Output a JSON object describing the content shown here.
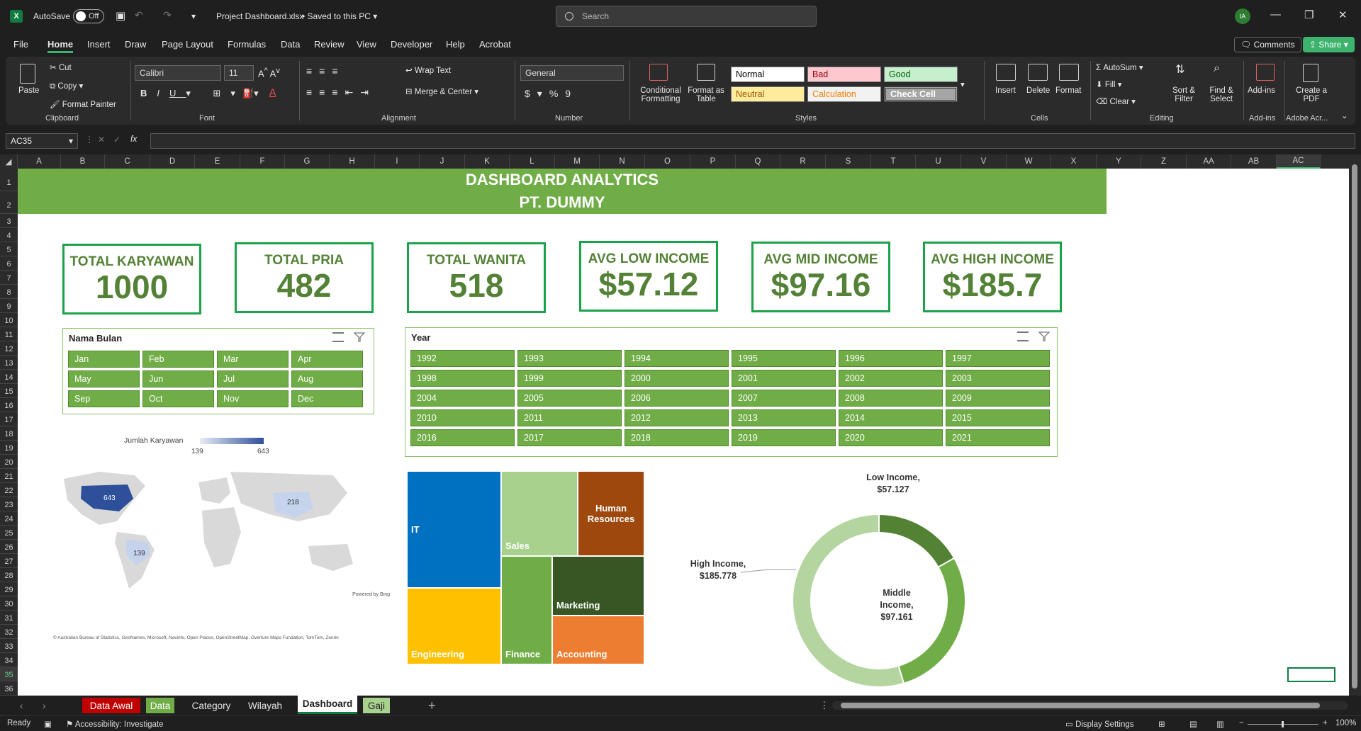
{
  "titlebar": {
    "autosave_label": "AutoSave",
    "autosave_state": "Off",
    "file_title": "Project Dashboard.xlsx",
    "save_status": "Saved to this PC",
    "search_placeholder": "Search",
    "user_initials": "IA"
  },
  "menu": [
    "File",
    "Home",
    "Insert",
    "Draw",
    "Page Layout",
    "Formulas",
    "Data",
    "Review",
    "View",
    "Developer",
    "Help",
    "Acrobat"
  ],
  "menu_active": "Home",
  "comments_label": "Comments",
  "share_label": "Share",
  "ribbon": {
    "clipboard": {
      "paste": "Paste",
      "cut": "Cut",
      "copy": "Copy",
      "format_painter": "Format Painter",
      "label": "Clipboard"
    },
    "font": {
      "name": "Calibri",
      "size": "11",
      "label": "Font"
    },
    "alignment": {
      "wrap": "Wrap Text",
      "merge": "Merge & Center",
      "label": "Alignment"
    },
    "number": {
      "format": "General",
      "label": "Number"
    },
    "styles": {
      "conditional": "Conditional Formatting",
      "format_table": "Format as Table",
      "cells": [
        {
          "name": "Normal",
          "bg": "#ffffff",
          "fg": "#000000"
        },
        {
          "name": "Bad",
          "bg": "#ffc7ce",
          "fg": "#9c0006"
        },
        {
          "name": "Good",
          "bg": "#c6efce",
          "fg": "#006100"
        },
        {
          "name": "Neutral",
          "bg": "#ffeb9c",
          "fg": "#9c5700"
        },
        {
          "name": "Calculation",
          "bg": "#f2f2f2",
          "fg": "#fa7d00"
        },
        {
          "name": "Check Cell",
          "bg": "#a5a5a5",
          "fg": "#ffffff"
        }
      ],
      "label": "Styles"
    },
    "cells": {
      "insert": "Insert",
      "delete": "Delete",
      "format": "Format",
      "label": "Cells"
    },
    "editing": {
      "autosum": "AutoSum",
      "fill": "Fill",
      "clear": "Clear",
      "sort": "Sort & Filter",
      "find": "Find & Select",
      "label": "Editing"
    },
    "addins": {
      "addins": "Add-ins",
      "label": "Add-ins"
    },
    "acrobat": {
      "create": "Create a PDF",
      "label": "Adobe Acr..."
    }
  },
  "formula_bar": {
    "name_box": "AC35",
    "fx": "fx",
    "content": ""
  },
  "columns": [
    "A",
    "B",
    "C",
    "D",
    "E",
    "F",
    "G",
    "H",
    "I",
    "J",
    "K",
    "L",
    "M",
    "N",
    "O",
    "P",
    "Q",
    "R",
    "S",
    "T",
    "U",
    "V",
    "W",
    "X",
    "Y",
    "Z",
    "AA",
    "AB",
    "AC"
  ],
  "selected_column": "AC",
  "rows": [
    "1",
    "2",
    "3",
    "4",
    "5",
    "6",
    "7",
    "8",
    "9",
    "10",
    "11",
    "12",
    "13",
    "14",
    "15",
    "16",
    "17",
    "18",
    "19",
    "20",
    "21",
    "22",
    "23",
    "24",
    "25",
    "26",
    "27",
    "28",
    "29",
    "30",
    "31",
    "32",
    "33",
    "34",
    "35",
    "36"
  ],
  "dashboard": {
    "title_line1": "DASHBOARD ANALYTICS",
    "title_line2": "PT. DUMMY",
    "kpis": [
      {
        "label": "TOTAL KARYAWAN",
        "value": "1000"
      },
      {
        "label": "TOTAL PRIA",
        "value": "482"
      },
      {
        "label": "TOTAL WANITA",
        "value": "518"
      },
      {
        "label": "AVG LOW INCOME",
        "value": "$57.12"
      },
      {
        "label": "AVG MID INCOME",
        "value": "$97.16"
      },
      {
        "label": "AVG HIGH INCOME",
        "value": "$185.7"
      }
    ],
    "slicer_month": {
      "title": "Nama Bulan",
      "items": [
        "Jan",
        "Feb",
        "Mar",
        "Apr",
        "May",
        "Jun",
        "Jul",
        "Aug",
        "Sep",
        "Oct",
        "Nov",
        "Dec"
      ]
    },
    "slicer_year": {
      "title": "Year",
      "items": [
        "1992",
        "1993",
        "1994",
        "1995",
        "1996",
        "1997",
        "1998",
        "1999",
        "2000",
        "2001",
        "2002",
        "2003",
        "2004",
        "2005",
        "2006",
        "2007",
        "2008",
        "2009",
        "2010",
        "2011",
        "2012",
        "2013",
        "2014",
        "2015",
        "2016",
        "2017",
        "2018",
        "2019",
        "2020",
        "2021"
      ]
    },
    "map": {
      "legend_title": "Jumlah Karyawan",
      "legend_min": "139",
      "legend_max": "643",
      "points": [
        {
          "country": "USA",
          "label": "643"
        },
        {
          "country": "China",
          "label": "218"
        },
        {
          "country": "Brazil",
          "label": "139"
        }
      ],
      "powered": "Powered by Bing",
      "credits": "© Australian Bureau of Statistics, GeoNames, Microsoft, Navinfo, Open Places, OpenStreetMap, Overture Maps Fundation, TomTom, Zenrin"
    }
  },
  "chart_data": [
    {
      "type": "treemap",
      "categories": [
        "IT",
        "Sales",
        "Human Resources",
        "Engineering",
        "Finance",
        "Marketing",
        "Accounting"
      ],
      "colors": [
        "#0070c0",
        "#a9d18e",
        "#9e480e",
        "#ffc000",
        "#70ad47",
        "#375623",
        "#ed7d31"
      ]
    },
    {
      "type": "pie",
      "variant": "doughnut",
      "categories": [
        "Low Income",
        "Middle Income",
        "High Income"
      ],
      "values": [
        57.127,
        97.161,
        185.778
      ],
      "labels": [
        "Low Income,\n$57.127",
        "Middle\nIncome,\n$97.161",
        "High Income,\n$185.778"
      ],
      "colors": [
        "#548235",
        "#70ad47",
        "#b5d5a0"
      ]
    }
  ],
  "sheet_tabs": [
    {
      "name": "Data Awal",
      "bg": "#c00000",
      "fg": "#ffffff"
    },
    {
      "name": "Data",
      "bg": "#70ad47",
      "fg": "#ffffff"
    },
    {
      "name": "Category",
      "bg": "",
      "fg": "#e6e6e6"
    },
    {
      "name": "Wilayah",
      "bg": "",
      "fg": "#e6e6e6"
    },
    {
      "name": "Dashboard",
      "bg": "#ffffff",
      "fg": "#1f1f1f"
    },
    {
      "name": "Gaji",
      "bg": "#a9d18e",
      "fg": "#1f1f1f"
    }
  ],
  "status": {
    "ready": "Ready",
    "accessibility": "Accessibility: Investigate",
    "display": "Display Settings",
    "zoom": "100%"
  }
}
